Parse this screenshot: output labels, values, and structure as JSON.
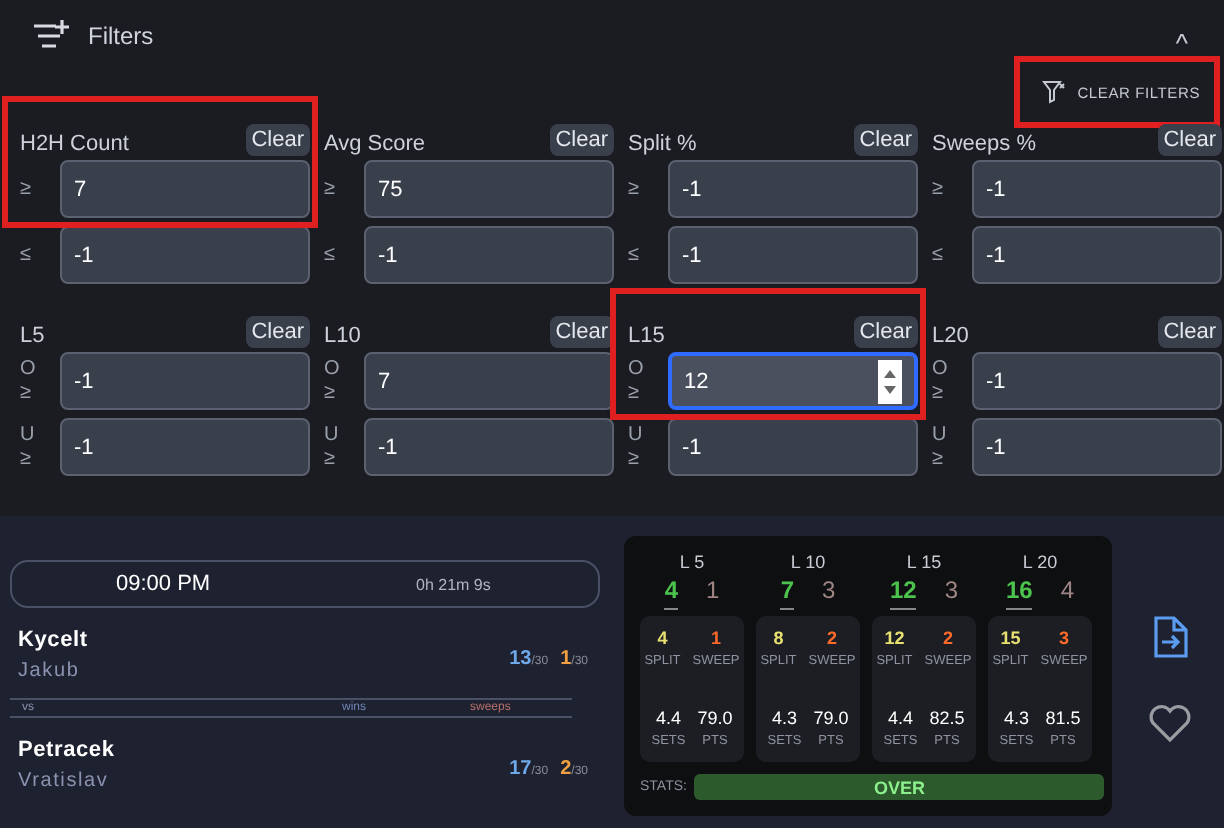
{
  "header": {
    "title": "Filters",
    "collapse": "^",
    "clear_filters": {
      "label": "CLEAR FILTERS",
      "highlighted": true
    }
  },
  "filters": [
    {
      "label": "H2H Count",
      "clear": "Clear",
      "highlighted": true,
      "rows": [
        {
          "prefix": "",
          "op": "≥",
          "value": "7",
          "focused": false
        },
        {
          "prefix": "",
          "op": "≤",
          "value": "-1",
          "focused": false
        }
      ]
    },
    {
      "label": "Avg Score",
      "clear": "Clear",
      "highlighted": false,
      "rows": [
        {
          "prefix": "",
          "op": "≥",
          "value": "75",
          "focused": false
        },
        {
          "prefix": "",
          "op": "≤",
          "value": "-1",
          "focused": false
        }
      ]
    },
    {
      "label": "Split %",
      "clear": "Clear",
      "highlighted": false,
      "rows": [
        {
          "prefix": "",
          "op": "≥",
          "value": "-1",
          "focused": false
        },
        {
          "prefix": "",
          "op": "≤",
          "value": "-1",
          "focused": false
        }
      ]
    },
    {
      "label": "Sweeps %",
      "clear": "Clear",
      "highlighted": false,
      "rows": [
        {
          "prefix": "",
          "op": "≥",
          "value": "-1",
          "focused": false
        },
        {
          "prefix": "",
          "op": "≤",
          "value": "-1",
          "focused": false
        }
      ]
    },
    {
      "label": "L5",
      "clear": "Clear",
      "highlighted": false,
      "rows": [
        {
          "prefix": "O",
          "op": "≥",
          "value": "-1",
          "focused": false
        },
        {
          "prefix": "U",
          "op": "≥",
          "value": "-1",
          "focused": false
        }
      ]
    },
    {
      "label": "L10",
      "clear": "Clear",
      "highlighted": false,
      "rows": [
        {
          "prefix": "O",
          "op": "≥",
          "value": "7",
          "focused": false
        },
        {
          "prefix": "U",
          "op": "≥",
          "value": "-1",
          "focused": false
        }
      ]
    },
    {
      "label": "L15",
      "clear": "Clear",
      "highlighted": true,
      "rows": [
        {
          "prefix": "O",
          "op": "≥",
          "value": "12",
          "focused": true
        },
        {
          "prefix": "U",
          "op": "≥",
          "value": "-1",
          "focused": false
        }
      ]
    },
    {
      "label": "L20",
      "clear": "Clear",
      "highlighted": false,
      "rows": [
        {
          "prefix": "O",
          "op": "≥",
          "value": "-1",
          "focused": false
        },
        {
          "prefix": "U",
          "op": "≥",
          "value": "-1",
          "focused": false
        }
      ]
    }
  ],
  "match": {
    "time": "09:00 PM",
    "countdown": "0h 21m 9s",
    "players": [
      {
        "last_name": "Kycelt",
        "first_name": "Jakub",
        "wins": "13",
        "wins_total": "/30",
        "sweeps": "1",
        "sweeps_total": "/30"
      },
      {
        "last_name": "Petracek",
        "first_name": "Vratislav",
        "wins": "17",
        "wins_total": "/30",
        "sweeps": "2",
        "sweeps_total": "/30"
      }
    ],
    "divider_labels": {
      "vs": "vs",
      "wins": "wins",
      "sweeps": "sweeps"
    }
  },
  "stats": {
    "columns": [
      {
        "label": "L 5",
        "over": "4",
        "under": "1",
        "split": "4",
        "sweep": "1",
        "split_label": "SPLIT",
        "sweep_label": "SWEEP",
        "sets": "4.4",
        "pts": "79.0",
        "sets_label": "SETS",
        "pts_label": "PTS"
      },
      {
        "label": "L 10",
        "over": "7",
        "under": "3",
        "split": "8",
        "sweep": "2",
        "split_label": "SPLIT",
        "sweep_label": "SWEEP",
        "sets": "4.3",
        "pts": "79.0",
        "sets_label": "SETS",
        "pts_label": "PTS"
      },
      {
        "label": "L 15",
        "over": "12",
        "under": "3",
        "split": "12",
        "sweep": "2",
        "split_label": "SPLIT",
        "sweep_label": "SWEEP",
        "sets": "4.4",
        "pts": "82.5",
        "sets_label": "SETS",
        "pts_label": "PTS"
      },
      {
        "label": "L 20",
        "over": "16",
        "under": "4",
        "split": "15",
        "sweep": "3",
        "split_label": "SPLIT",
        "sweep_label": "SWEEP",
        "sets": "4.3",
        "pts": "81.5",
        "sets_label": "SETS",
        "pts_label": "PTS"
      }
    ],
    "stats_label": "STATS:",
    "verdict": "OVER"
  }
}
